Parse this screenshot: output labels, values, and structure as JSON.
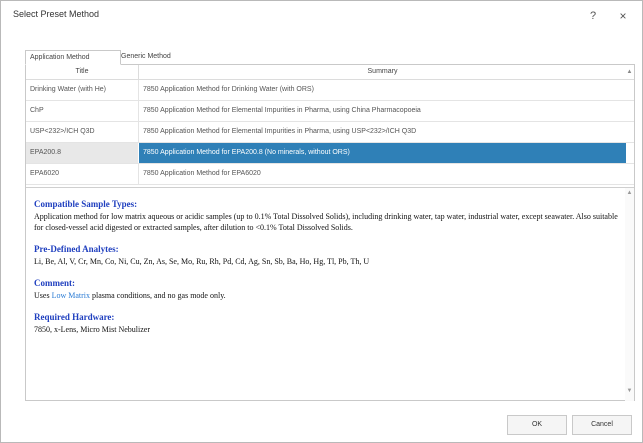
{
  "window": {
    "title": "Select Preset Method",
    "help_label": "?",
    "close_label": "×"
  },
  "tabs": [
    {
      "label": "Application Method",
      "active": true
    },
    {
      "label": "Generic Method",
      "active": false
    }
  ],
  "grid": {
    "columns": [
      "Title",
      "Summary"
    ],
    "rows": [
      {
        "title": "Drinking Water (with He)",
        "summary": "7850 Application Method for Drinking Water (with ORS)",
        "selected": false
      },
      {
        "title": "ChP",
        "summary": "7850 Application Method for Elemental Impurities in Pharma, using China Pharmacopoeia",
        "selected": false
      },
      {
        "title": "USP<232>/ICH Q3D",
        "summary": "7850 Application Method for Elemental Impurities in Pharma, using USP<232>/ICH Q3D",
        "selected": false
      },
      {
        "title": "EPA200.8",
        "summary": "7850 Application Method for EPA200.8 (No minerals, without ORS)",
        "selected": true
      },
      {
        "title": "EPA6020",
        "summary": "7850 Application Method for EPA6020",
        "selected": false
      }
    ]
  },
  "details": {
    "compatible_heading": "Compatible Sample Types:",
    "compatible_text": "Application method for low matrix aqueous or acidic samples (up to 0.1% Total Dissolved Solids), including drinking water, tap water, industrial water, except seawater. Also suitable for closed-vessel acid digested or extracted samples, after dilution to <0.1% Total Dissolved Solids.",
    "analytes_heading": "Pre-Defined Analytes:",
    "analytes_text": "Li, Be, Al, V, Cr, Mn, Co, Ni, Cu, Zn, As, Se, Mo, Ru, Rh, Pd, Cd, Ag, Sn, Sb, Ba, Ho, Hg, Tl, Pb, Th, U",
    "comment_heading": "Comment:",
    "comment_prefix": "Uses",
    "comment_link": "Low Matrix",
    "comment_suffix": "plasma conditions, and no gas mode only.",
    "hardware_heading": "Required Hardware:",
    "hardware_text": "7850, x-Lens, Micro Mist Nebulizer"
  },
  "buttons": {
    "ok": "OK",
    "cancel": "Cancel"
  },
  "colors": {
    "selection": "#2f80b7",
    "heading": "#1f3fbf",
    "link": "#2a7bd4"
  }
}
